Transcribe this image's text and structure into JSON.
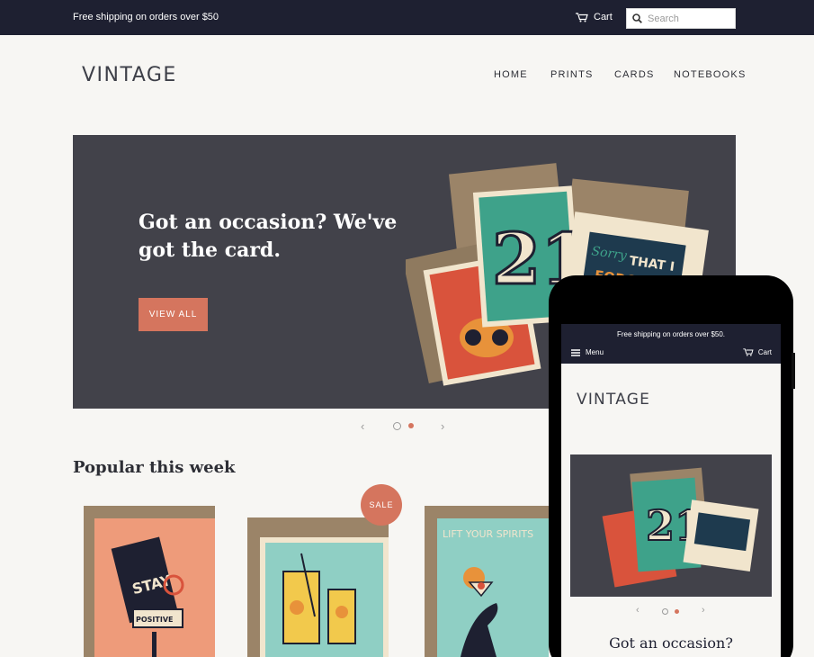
{
  "topbar": {
    "promo": "Free shipping on orders over $50",
    "cart_label": "Cart",
    "search_placeholder": "Search"
  },
  "header": {
    "logo": "VINTAGE",
    "nav": [
      "HOME",
      "PRINTS",
      "CARDS",
      "NOTEBOOKS"
    ]
  },
  "hero": {
    "heading": "Got an occasion? We've got the card.",
    "button": "VIEW ALL",
    "card_number": "21",
    "card_text_1": "Sorry",
    "card_text_2": "THAT I",
    "card_text_3": "FORGOT"
  },
  "slider": {
    "prev": "‹",
    "next": "›"
  },
  "popular": {
    "title": "Popular this week",
    "sale_badge": "SALE",
    "products": [
      {
        "art_text_1": "STAY",
        "art_text_2": "POSITIVE"
      },
      {
        "art_text_1": ""
      },
      {
        "art_text_1": "LIFT YOUR SPIRITS"
      }
    ]
  },
  "mobile": {
    "promo": "Free shipping on orders over $50.",
    "menu_label": "Menu",
    "cart_label": "Cart",
    "logo": "VINTAGE",
    "heading": "Got an occasion?"
  },
  "colors": {
    "topbar": "#1e2031",
    "accent": "#d5755e",
    "hero_bg": "#42424a",
    "page_bg": "#f7f6f3"
  }
}
